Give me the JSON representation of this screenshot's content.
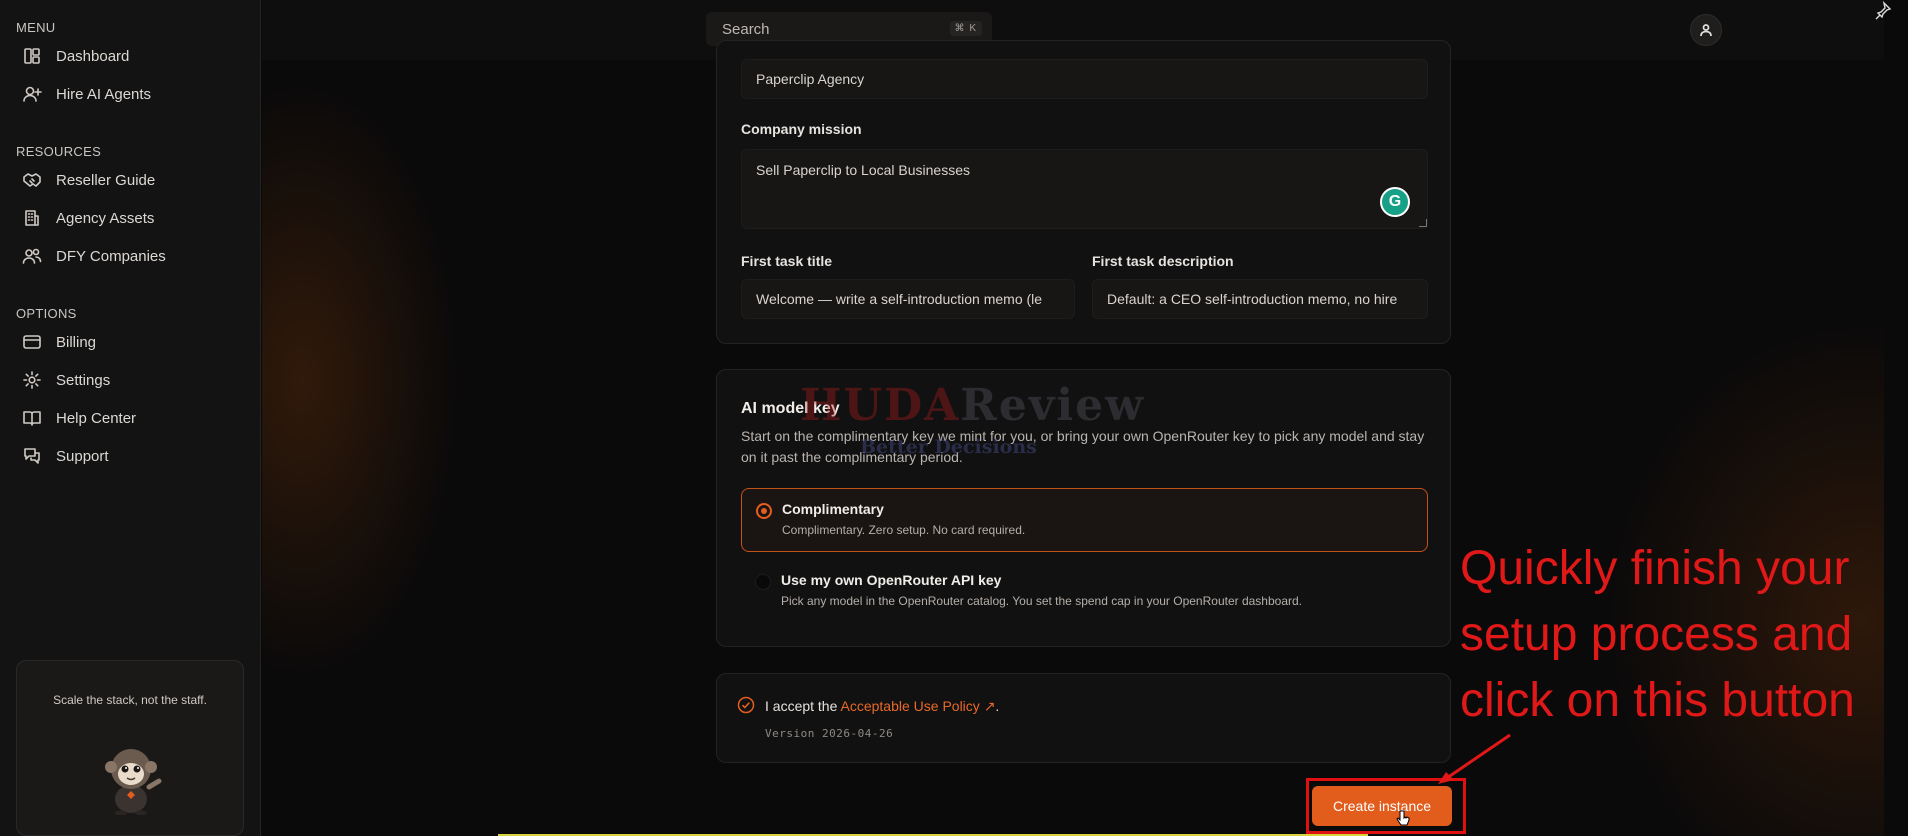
{
  "sidebar": {
    "menu_title": "MENU",
    "menu_items": [
      {
        "label": "Dashboard",
        "icon": "dashboard-icon"
      },
      {
        "label": "Hire AI Agents",
        "icon": "user-plus-icon"
      }
    ],
    "resources_title": "RESOURCES",
    "resource_items": [
      {
        "label": "Reseller Guide",
        "icon": "handshake-icon"
      },
      {
        "label": "Agency Assets",
        "icon": "building-icon"
      },
      {
        "label": "DFY Companies",
        "icon": "users-icon"
      }
    ],
    "options_title": "OPTIONS",
    "option_items": [
      {
        "label": "Billing",
        "icon": "credit-card-icon"
      },
      {
        "label": "Settings",
        "icon": "gear-icon"
      },
      {
        "label": "Help Center",
        "icon": "book-icon"
      },
      {
        "label": "Support",
        "icon": "chat-icon"
      }
    ],
    "promo_text": "Scale the stack, not the staff."
  },
  "topbar": {
    "search_placeholder": "Search",
    "search_shortcut": "⌘ K"
  },
  "form": {
    "company_name_value": "Paperclip Agency",
    "mission_label": "Company mission",
    "mission_value": "Sell Paperclip to Local Businesses",
    "first_task_title_label": "First task title",
    "first_task_title_value": "Welcome — write a self-introduction memo (le",
    "first_task_desc_label": "First task description",
    "first_task_desc_value": "Default: a CEO self-introduction memo, no hire"
  },
  "ai_model": {
    "title": "AI model key",
    "description": "Start on the complimentary key we mint for you, or bring your own OpenRouter key to pick any model and stay on it past the complimentary period.",
    "options": [
      {
        "title": "Complimentary",
        "subtitle": "Complimentary. Zero setup. No card required.",
        "selected": true
      },
      {
        "title": "Use my own OpenRouter API key",
        "subtitle": "Pick any model in the OpenRouter catalog. You set the spend cap in your OpenRouter dashboard.",
        "selected": false
      }
    ]
  },
  "policy": {
    "accept_prefix": "I accept the ",
    "link_text": "Acceptable Use Policy",
    "accept_suffix": ".",
    "version": "Version 2026-04-26"
  },
  "actions": {
    "create_label": "Create instance"
  },
  "annotation": {
    "text": "Quickly finish your setup process and click on this button"
  },
  "watermark": {
    "brand_a": "HUDA",
    "brand_b": "Review",
    "tagline": "Better Decisions"
  },
  "colors": {
    "accent": "#e25c1c",
    "annotation_red": "#e01818",
    "background": "#0b0a0a"
  }
}
